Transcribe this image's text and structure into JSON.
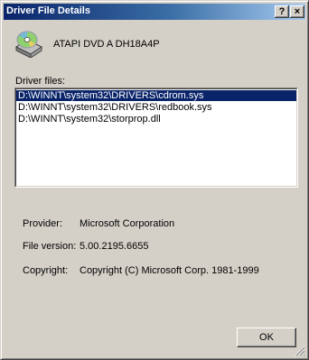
{
  "window": {
    "title": "Driver File Details"
  },
  "titlebar_buttons": {
    "help": "?",
    "close": "×"
  },
  "device": {
    "name": "ATAPI DVD A  DH18A4P",
    "icon": "cd-drive-icon"
  },
  "files": {
    "label": "Driver files:",
    "items": [
      "D:\\WINNT\\system32\\DRIVERS\\cdrom.sys",
      "D:\\WINNT\\system32\\DRIVERS\\redbook.sys",
      "D:\\WINNT\\system32\\storprop.dll"
    ],
    "selected_index": 0
  },
  "details": {
    "provider_label": "Provider:",
    "provider_value": "Microsoft Corporation",
    "version_label": "File version:",
    "version_value": "5.00.2195.6655",
    "copyright_label": "Copyright:",
    "copyright_value": "Copyright (C) Microsoft Corp. 1981-1999"
  },
  "buttons": {
    "ok": "OK"
  }
}
